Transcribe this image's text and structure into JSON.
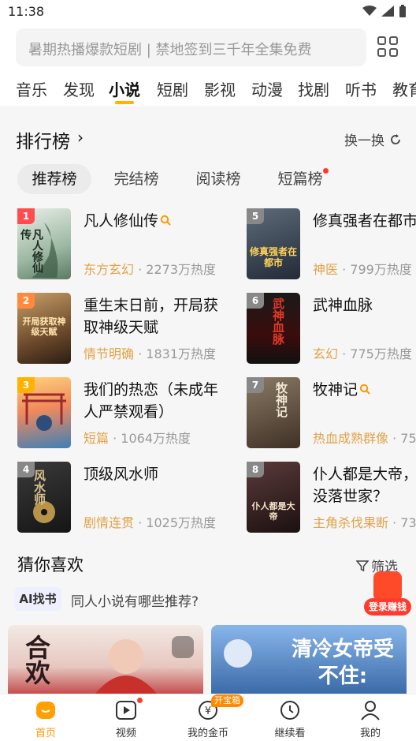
{
  "status": {
    "time": "11:38"
  },
  "search": {
    "placeholder": "暑期热播爆款短剧 | 禁地签到三千年全集免费"
  },
  "channels": [
    "音乐",
    "发现",
    "小说",
    "短剧",
    "影视",
    "动漫",
    "找剧",
    "听书",
    "教育"
  ],
  "active_channel": "小说",
  "ranking": {
    "title": "排行榜",
    "change": "换一换",
    "tabs": [
      "推荐榜",
      "完结榜",
      "阅读榜",
      "短篇榜"
    ],
    "books": [
      {
        "rank": "1",
        "title_lines": [
          "凡人修仙传"
        ],
        "search_icon": true,
        "tag": "东方玄幻",
        "heat": " · 2273万热度"
      },
      {
        "rank": "2",
        "title_lines": [
          "重生末日前，开局获",
          "取神级天赋"
        ],
        "tag": "情节明确",
        "heat": " · 1831万热度"
      },
      {
        "rank": "3",
        "title_lines": [
          "我们的热恋（未成年",
          "人严禁观看）"
        ],
        "tag": "短篇",
        "heat": " · 1064万热度"
      },
      {
        "rank": "4",
        "title_lines": [
          "顶级风水师"
        ],
        "tag": "剧情连贯",
        "heat": " · 1025万热度"
      },
      {
        "rank": "5",
        "title_lines": [
          "修真强者在都市"
        ],
        "tag": "神医",
        "heat": " · 799万热度"
      },
      {
        "rank": "6",
        "title_lines": [
          "武神血脉"
        ],
        "tag": "玄幻",
        "heat": " · 775万热度"
      },
      {
        "rank": "7",
        "title_lines": [
          "牧神记"
        ],
        "search_icon": true,
        "tag": "热血成熟群像",
        "heat": " · 75"
      },
      {
        "rank": "8",
        "title_lines": [
          "仆人都是大帝，",
          "没落世家？"
        ],
        "tag": "主角杀伐果断",
        "heat": " · 73"
      }
    ],
    "covers_text": {
      "c1": "凡人修仙传",
      "c2": "开局获取神级天赋",
      "c4": "风水师",
      "c5": "修真强者在都市",
      "c6": "武神血脉",
      "c7": "牧神记",
      "c8": "仆人都是大帝"
    }
  },
  "guess": {
    "title": "猜你喜欢",
    "filter": "筛选",
    "ai_badge": "AI找书",
    "ai_query": "同人小说有哪些推荐?",
    "card1_text": "合欢",
    "card2_text": "清冷女帝受不住:"
  },
  "login_reward": "登录赚钱",
  "bottom_nav": {
    "home": "首页",
    "video": "视频",
    "coins": "我的金币",
    "treasure": "开宝箱",
    "continue": "继续看",
    "mine": "我的"
  },
  "colors": {
    "accent": "#ffb300",
    "tag": "#e0a34a",
    "rank1": "#ff4d4f",
    "rank2": "#ff8a3d",
    "rank3": "#ffb300",
    "rank_other": "#888888"
  }
}
